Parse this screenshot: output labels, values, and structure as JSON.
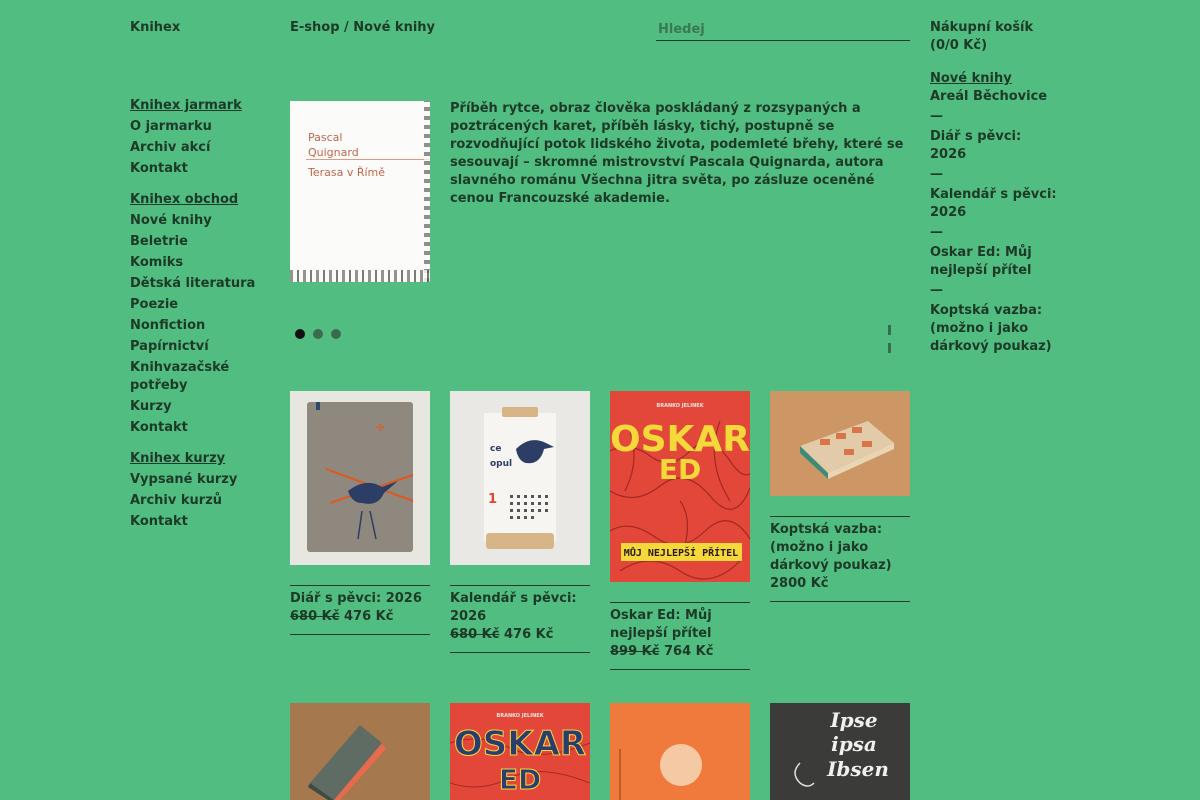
{
  "header": {
    "logo": "Knihex",
    "breadcrumb": "E-shop / Nové knihy",
    "search_placeholder": "Hledej"
  },
  "sidebar": {
    "groups": [
      {
        "head": "Knihex jarmark",
        "items": [
          "O jarmarku",
          "Archiv akcí",
          "Kontakt"
        ]
      },
      {
        "head": "Knihex obchod",
        "items": [
          "Nové knihy",
          "Beletrie",
          "Komiks",
          "Dětská literatura",
          "Poezie",
          "Nonfiction",
          "Papírnictví",
          "Knihvazačské potřeby",
          "Kurzy",
          "Kontakt"
        ]
      },
      {
        "head": "Knihex kurzy",
        "items": [
          "Vypsané kurzy",
          "Archiv kurzů",
          "Kontakt"
        ]
      }
    ]
  },
  "featured": {
    "cover_author": "Pascal Quignard",
    "cover_title": "Terasa v Římě",
    "text": "Příběh rytce, obraz člověka poskládaný z rozsypaných a poztrácených karet, příběh lásky, tichý, postupně se rozvodňující potok lidského života, podemleté břehy, které se sesouvají – skromné mistrovství Pascala Quignarda, autora slavného románu Všechna jitra světa, po zásluze oceněné cenou Francouzské akademie.",
    "slides": 3,
    "active_slide": 1
  },
  "products": [
    {
      "title": "Diář s pěvci: 2026",
      "old_price": "680 Kč",
      "price": "476 Kč"
    },
    {
      "title": "Kalendář s pěvci: 2026",
      "old_price": "680 Kč",
      "price": "476 Kč"
    },
    {
      "title": "Oskar Ed: Můj nejlepší přítel",
      "old_price": "899 Kč",
      "price": "764 Kč"
    },
    {
      "title": "Koptská vazba: (možno i jako dárkový poukaz)",
      "old_price": "",
      "price": "2800 Kč"
    }
  ],
  "product_covers": {
    "oskar_word1": "OSKAR",
    "oskar_word2": "ED",
    "oskar_band": "MŮJ NEJLEPŠÍ PŘÍTEL",
    "oskar_author": "BRANKO JELINEK",
    "ipse_title": "Ipse ipsa Ibsen"
  },
  "cart": {
    "title": "Nákupní košík",
    "summary": "(0/0 Kč)",
    "list_head": "Nové knihy",
    "items": [
      "Areál Běchovice",
      "Diář s pěvci: 2026",
      "Kalendář s pěvci: 2026",
      "Oskar Ed: Můj nejlepší přítel",
      "Koptská vazba: (možno i jako dárkový poukaz)"
    ],
    "separator": "—"
  },
  "colors": {
    "background": "#52bd80",
    "text": "#1d3a28",
    "oskar_red": "#e2473a",
    "oskar_yellow": "#f5d93a",
    "orange_cover": "#f07a3c",
    "dark_cover": "#3b3b39"
  }
}
